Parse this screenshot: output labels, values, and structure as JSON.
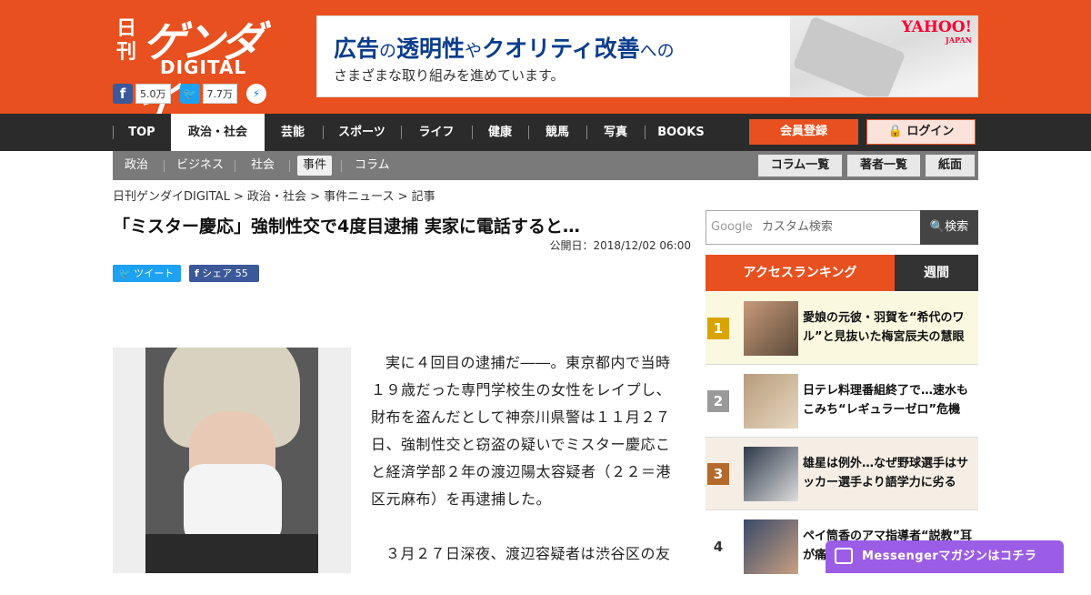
{
  "header": {
    "logo_nikkan": "日刊",
    "logo_gendai": "ゲンダイ",
    "logo_digital": "DIGITAL",
    "facebook_count": "5.0万",
    "twitter_count": "7.7万"
  },
  "ad": {
    "headline_a": "広告",
    "headline_no": "の",
    "headline_b": "透明性",
    "headline_ya": "や",
    "headline_c": "クオリティ改善",
    "headline_he": "への",
    "subline": "さまざまな取り組みを進めています。",
    "brand": "YAHOO!",
    "brand_sub": "JAPAN"
  },
  "nav": {
    "items": [
      "TOP",
      "政治・社会",
      "芸能",
      "スポーツ",
      "ライフ",
      "健康",
      "競馬",
      "写真",
      "BOOKS"
    ],
    "register": "会員登録",
    "login": "ログイン"
  },
  "subnav": {
    "items": [
      "政治",
      "ビジネス",
      "社会",
      "事件",
      "コラム"
    ],
    "buttons": [
      "コラム一覧",
      "著者一覧",
      "紙面"
    ]
  },
  "breadcrumb": "日刊ゲンダイDIGITAL > 政治・社会 > 事件ニュース > 記事",
  "article": {
    "title": "「ミスター慶応」強制性交で4度目逮捕 実家に電話すると…",
    "published": "公開日：2018/12/02 06:00",
    "tweet_label": "ツイート",
    "share_label": "シェア",
    "share_count": "55",
    "paragraph1": "実に４回目の逮捕だ――。東京都内で当時１９歳だった専門学校生の女性をレイプし、財布を盗んだとして神奈川県警は１１月２７日、強制性交と窃盗の疑いでミスター慶応こと経済学部２年の渡辺陽太容疑者（２２＝港区元麻布）を再逮捕した。",
    "paragraph2": "３月２７日深夜、渡辺容疑者は渋谷区の友"
  },
  "search": {
    "google": "Google",
    "placeholder": "カスタム検索",
    "button": "検索"
  },
  "ranking": {
    "tab_access": "アクセスランキング",
    "tab_weekly": "週間",
    "items": [
      {
        "rank": "1",
        "title": "愛娘の元彼・羽賀を“希代のワル”と見抜いた梅宮辰夫の慧眼"
      },
      {
        "rank": "2",
        "title": "日テレ料理番組終了で…速水もこみち“レギュラーゼロ”危機"
      },
      {
        "rank": "3",
        "title": "雄星は例外…なぜ野球選手はサッカー選手より語学力に劣る"
      },
      {
        "rank": "4",
        "title": "ペイ筒香のアマ指導者“説教”耳が痛"
      }
    ]
  },
  "messenger": "Messengerマガジンはコチラ",
  "colors": {
    "brand": "#e8501f",
    "nav": "#2b2b2b",
    "rank1": "#d9a400",
    "rank2": "#9a9a9a",
    "rank3": "#b46a2c",
    "rank4": "#333333"
  }
}
